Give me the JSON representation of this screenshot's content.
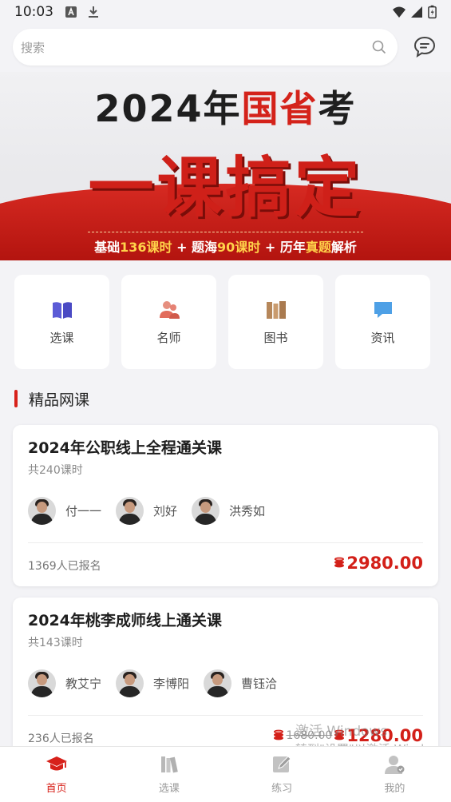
{
  "status_bar": {
    "time": "10:03"
  },
  "search": {
    "placeholder": "搜索"
  },
  "banner": {
    "year_text": "2024年",
    "accent_text": "国省",
    "exam_text": "考",
    "big_text": "一课搞定",
    "sub_parts": [
      "基础",
      "136课时",
      "+ 题海",
      "90课时",
      "+ 历年",
      "真题",
      "解析"
    ]
  },
  "categories": [
    {
      "label": "选课",
      "icon": "book-icon",
      "color": "#5b5bd6"
    },
    {
      "label": "名师",
      "icon": "teacher-icon",
      "color": "#e26c5c"
    },
    {
      "label": "图书",
      "icon": "books-icon",
      "color": "#b6875a"
    },
    {
      "label": "资讯",
      "icon": "chat-icon",
      "color": "#4ea0e6"
    }
  ],
  "section": {
    "title": "精品网课"
  },
  "courses": [
    {
      "title": "2024年公职线上全程通关课",
      "hours": "共240课时",
      "teachers": [
        "付一一",
        "刘好",
        "洪秀如"
      ],
      "enrolled": "1369人已报名",
      "price": "2980.00"
    },
    {
      "title": "2024年桃李成师线上通关课",
      "hours": "共143课时",
      "teachers": [
        "教艾宁",
        "李博阳",
        "曹钰洽"
      ],
      "enrolled": "236人已报名",
      "old_price": "1680.00",
      "price": "1280.00"
    }
  ],
  "watermark": {
    "line1": "激活 Windows",
    "line2": "转到\"设置\"以激活 Windows。"
  },
  "tabs": [
    {
      "label": "首页",
      "icon": "graduation-cap-icon",
      "active": true
    },
    {
      "label": "选课",
      "icon": "books-icon",
      "active": false
    },
    {
      "label": "练习",
      "icon": "edit-icon",
      "active": false
    },
    {
      "label": "我的",
      "icon": "user-icon",
      "active": false
    }
  ],
  "colors": {
    "accent": "#d7211a",
    "background": "#f3f3f6"
  }
}
